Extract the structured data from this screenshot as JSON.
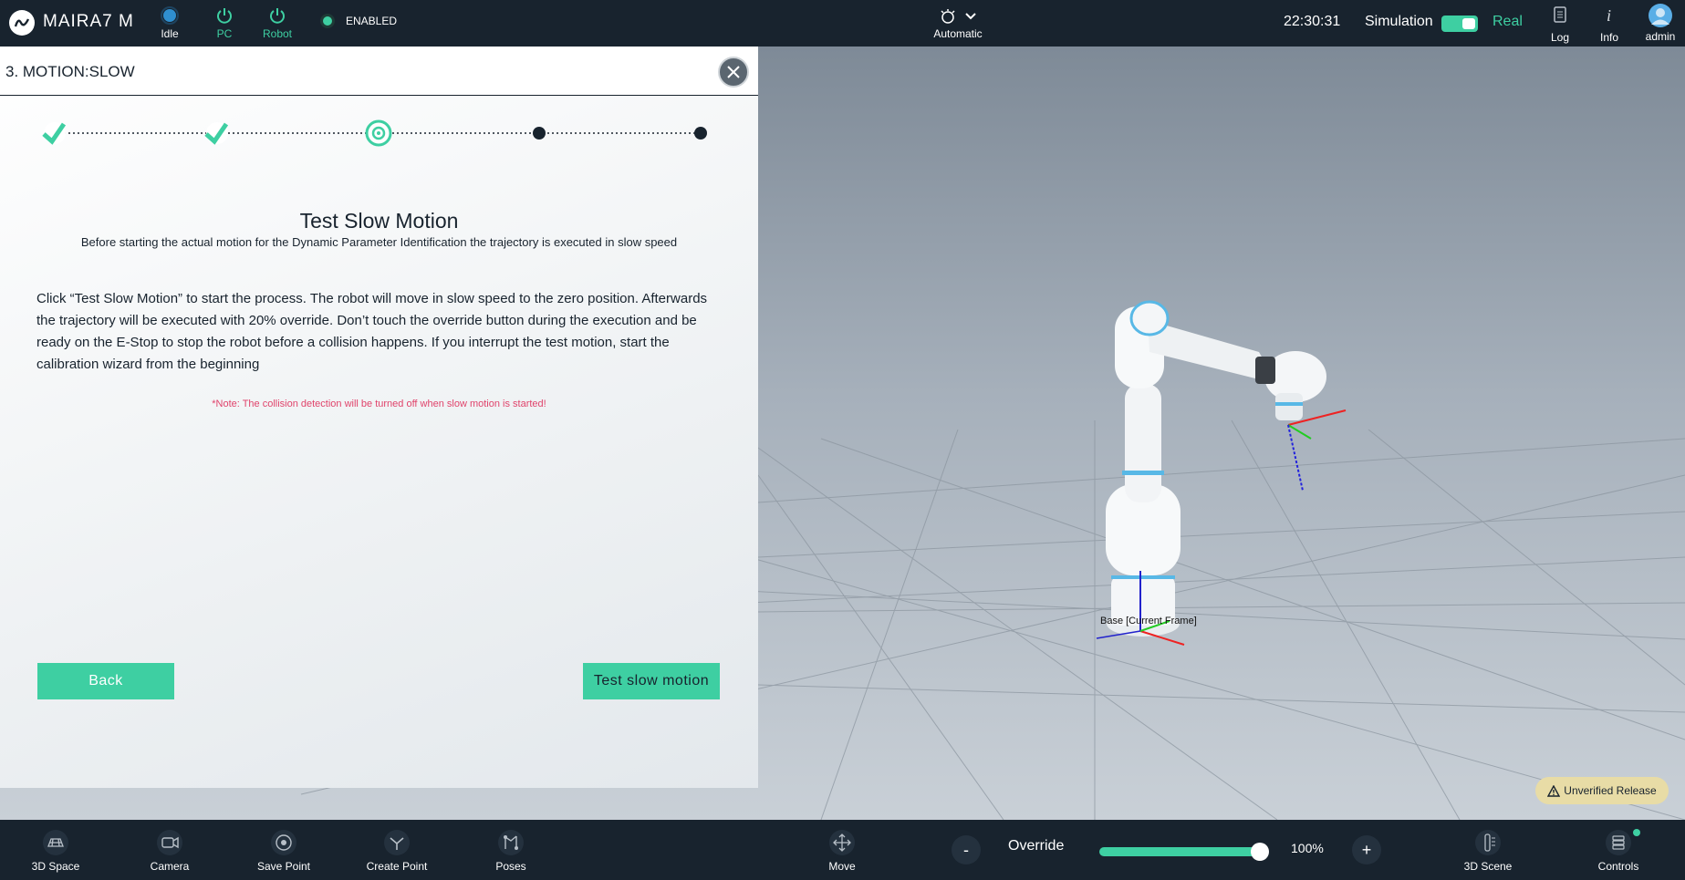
{
  "app": {
    "title": "MAIRA7 M"
  },
  "status": {
    "idle": "Idle",
    "pc": "PC",
    "robot": "Robot",
    "enabled": "ENABLED",
    "mode": "Automatic",
    "clock": "22:30:31",
    "simulation": "Simulation",
    "real": "Real",
    "simulation_toggle_on": true
  },
  "topright": {
    "log": "Log",
    "info": "Info",
    "user": "admin"
  },
  "panel": {
    "title": "3. MOTION:SLOW",
    "step_title": "Test Slow Motion",
    "step_subtitle": "Before starting the actual motion for the Dynamic Parameter Identification the trajectory is executed in slow speed",
    "body": "Click “Test Slow Motion” to start the process. The robot will move in slow speed to the zero position. Afterwards the trajectory will be executed with 20% override. Don’t touch the override button during the execution and be ready on the E-Stop to stop the robot before a collision happens. If you interrupt the test motion, start the calibration wizard from the beginning",
    "note": "*Note: The collision detection will be turned off when slow motion is started!",
    "back_label": "Back",
    "test_label": "Test slow motion",
    "steps": [
      "done",
      "done",
      "current",
      "pending",
      "pending"
    ]
  },
  "scene": {
    "frame_label": "Base [Current Frame]",
    "release_badge": "Unverified Release"
  },
  "bottombar": {
    "space": "3D Space",
    "camera": "Camera",
    "save_point": "Save Point",
    "create_point": "Create Point",
    "poses": "Poses",
    "move": "Move",
    "override_label": "Override",
    "override_value": "100%",
    "override_fraction": 1.0,
    "minus": "-",
    "plus": "+",
    "scene": "3D Scene",
    "controls": "Controls"
  },
  "colors": {
    "accent": "#3ecfa2",
    "dark": "#18232e",
    "note": "#e0436b",
    "badge": "#e8dca6"
  }
}
